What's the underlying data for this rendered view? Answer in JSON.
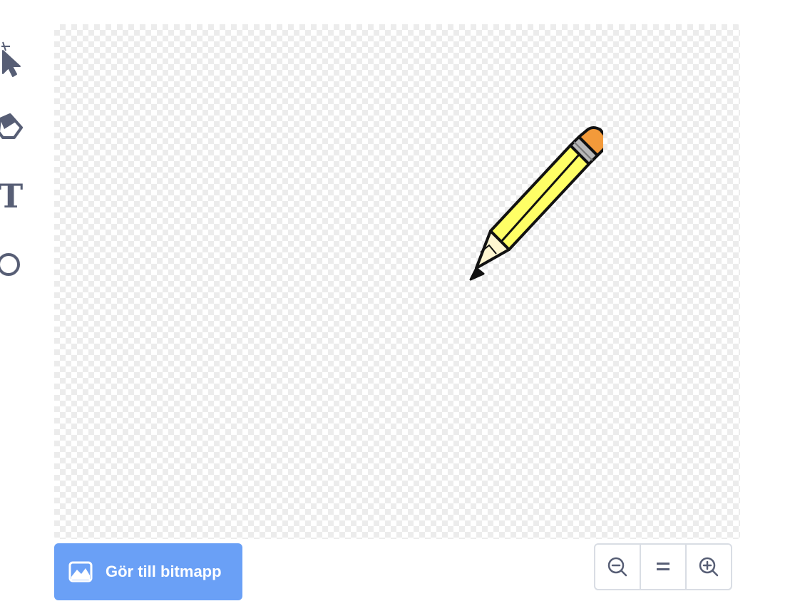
{
  "toolbar": {
    "tools": [
      {
        "name": "select",
        "icon": "reshape-cursor-icon"
      },
      {
        "name": "eraser",
        "icon": "eraser-icon"
      },
      {
        "name": "text",
        "icon": "text-icon",
        "glyph": "T"
      },
      {
        "name": "circle",
        "icon": "circle-icon"
      }
    ]
  },
  "canvas": {
    "sprite": "pencil"
  },
  "actions": {
    "convert_label": "Gör till bitmapp",
    "convert_icon": "bitmap-image-icon"
  },
  "zoom": {
    "out_icon": "zoom-out-icon",
    "reset_glyph": "=",
    "in_icon": "zoom-in-icon"
  },
  "colors": {
    "accent": "#6aa0f6",
    "icon": "#575e75",
    "pencil_body": "#ffff66",
    "pencil_eraser": "#f39a3a",
    "pencil_ferrule": "#b8b8b8",
    "pencil_wood": "#fff6d0"
  }
}
